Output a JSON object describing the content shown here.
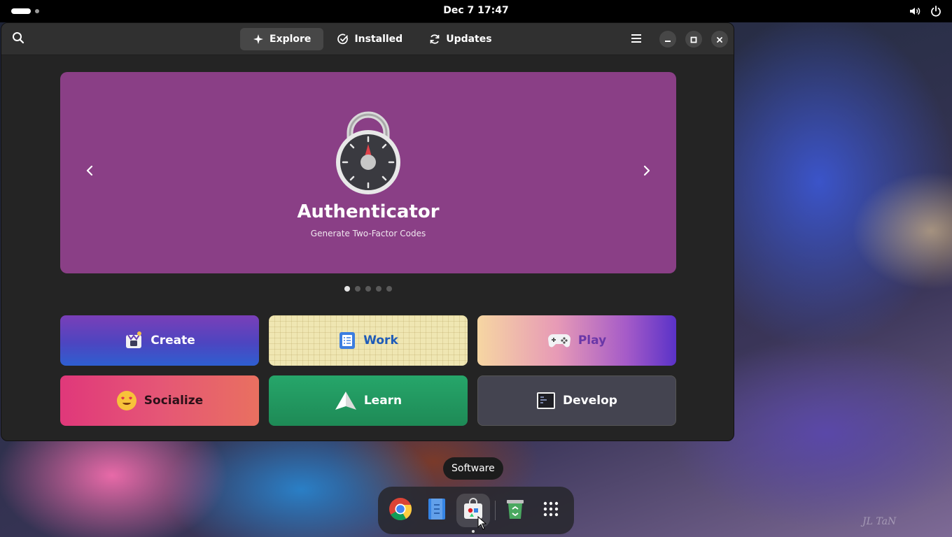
{
  "topbar": {
    "clock": "Dec 7  17:47"
  },
  "icons": {
    "volume": "volume-icon",
    "power": "power-icon",
    "search": "search-icon",
    "menu": "hamburger-menu-icon",
    "minimize": "minimize-icon",
    "maximize": "maximize-icon",
    "close": "close-icon"
  },
  "header": {
    "tabs": [
      {
        "label": "Explore",
        "icon": "sparkle-icon",
        "active": true
      },
      {
        "label": "Installed",
        "icon": "check-circle-icon",
        "active": false
      },
      {
        "label": "Updates",
        "icon": "refresh-icon",
        "active": false
      }
    ]
  },
  "banner": {
    "app_name": "Authenticator",
    "app_description": "Generate Two-Factor Codes",
    "background": "#8a3f86",
    "page_count": 5,
    "current_page": 1
  },
  "categories": [
    {
      "label": "Create",
      "icon": "create-icon"
    },
    {
      "label": "Work",
      "icon": "work-icon"
    },
    {
      "label": "Play",
      "icon": "gamepad-icon"
    },
    {
      "label": "Socialize",
      "icon": "smiley-icon"
    },
    {
      "label": "Learn",
      "icon": "learn-icon"
    },
    {
      "label": "Develop",
      "icon": "terminal-icon"
    }
  ],
  "dock": {
    "tooltip": "Software",
    "items": [
      "chrome-icon",
      "text-editor-icon",
      "software-icon",
      "trash-icon",
      "app-grid-icon"
    ]
  },
  "wallpaper": {
    "watermark": "JL TaN"
  }
}
